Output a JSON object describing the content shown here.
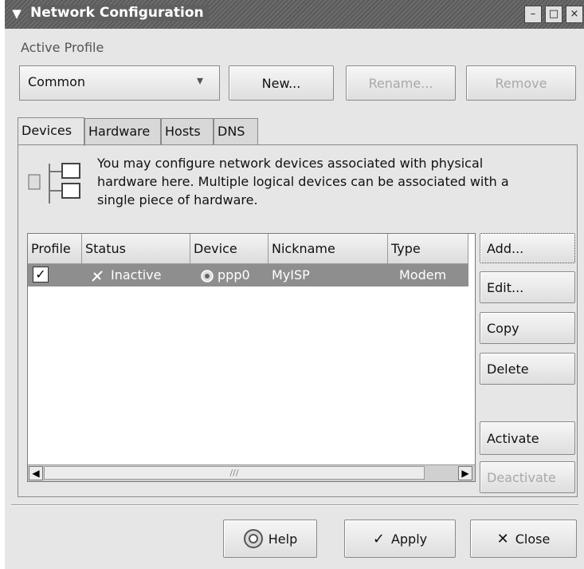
{
  "window": {
    "title": "Network Configuration",
    "minimize": "–",
    "maximize": "□",
    "close": "×",
    "menu": "▼"
  },
  "profile": {
    "group_label": "Active Profile",
    "selected": "Common",
    "dropdown_arrow": "▾",
    "new_label": "New...",
    "rename_label": "Rename...",
    "remove_label": "Remove"
  },
  "tabs": [
    {
      "label": "Devices"
    },
    {
      "label": "Hardware"
    },
    {
      "label": "Hosts"
    },
    {
      "label": "DNS"
    }
  ],
  "devices": {
    "info_text": "You may configure network devices associated with physical hardware here.  Multiple logical devices can be associated with a single piece of hardware.",
    "columns": [
      "Profile",
      "Status",
      "Device",
      "Nickname",
      "Type"
    ],
    "rows": [
      {
        "profile": "✓",
        "status": "Inactive",
        "device": "ppp0",
        "nickname": "MyISP",
        "type": "Modem"
      }
    ],
    "scroll_grip": "///",
    "scroll_left": "◀",
    "scroll_right": "▶"
  },
  "side_buttons": {
    "add": "Add...",
    "edit": "Edit...",
    "copy": "Copy",
    "delete": "Delete",
    "activate": "Activate",
    "deactivate": "Deactivate"
  },
  "footer": {
    "help": "Help",
    "apply": "Apply",
    "close": "Close",
    "apply_icon": "✓",
    "close_icon": "✕"
  }
}
